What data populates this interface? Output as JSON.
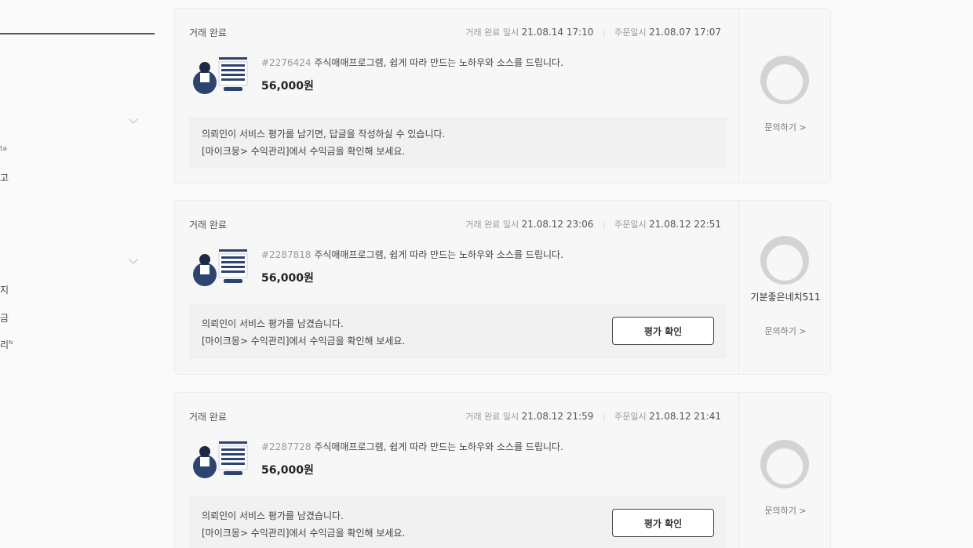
{
  "sidebar": {
    "fragments": [
      "ta",
      "고",
      "지",
      "금",
      "리"
    ],
    "badge": "N"
  },
  "orders": [
    {
      "status": "거래 완료",
      "complete_label": "거래 완료 일시",
      "complete_date": "21.08.14 17:10",
      "order_label": "주문일시",
      "order_date": "21.08.07 17:07",
      "order_no": "#2276424",
      "title": "주식매매프로그램, 쉽게 따라 만드는 노하우와 소스를 드립니다.",
      "price": "56,000원",
      "message_1": "의뢰인이 서비스 평가를 남기면, 답글을 작성하실 수 있습니다.",
      "message_2": "[마이크몽> 수익관리]에서 수익금을 확인해 보세요.",
      "seller": "",
      "inquiry": "문의하기 >"
    },
    {
      "status": "거래 완료",
      "complete_label": "거래 완료 일시",
      "complete_date": "21.08.12 23:06",
      "order_label": "주문일시",
      "order_date": "21.08.12 22:51",
      "order_no": "#2287818",
      "title": "주식매매프로그램, 쉽게 따라 만드는 노하우와 소스를 드립니다.",
      "price": "56,000원",
      "message_1": "의뢰인이 서비스 평가를 남겼습니다.",
      "message_2": "[마이크몽> 수익관리]에서 수익금을 확인해 보세요.",
      "review_button": "평가 확인",
      "seller": "기분좋은네치511",
      "inquiry": "문의하기 >"
    },
    {
      "status": "거래 완료",
      "complete_label": "거래 완료 일시",
      "complete_date": "21.08.12 21:59",
      "order_label": "주문일시",
      "order_date": "21.08.12 21:41",
      "order_no": "#2287728",
      "title": "주식매매프로그램, 쉽게 따라 만드는 노하우와 소스를 드립니다.",
      "price": "56,000원",
      "message_1": "의뢰인이 서비스 평가를 남겼습니다.",
      "message_2": "[마이크몽> 수익관리]에서 수익금을 확인해 보세요.",
      "review_button": "평가 확인",
      "seller": "",
      "inquiry": "문의하기 >"
    }
  ]
}
